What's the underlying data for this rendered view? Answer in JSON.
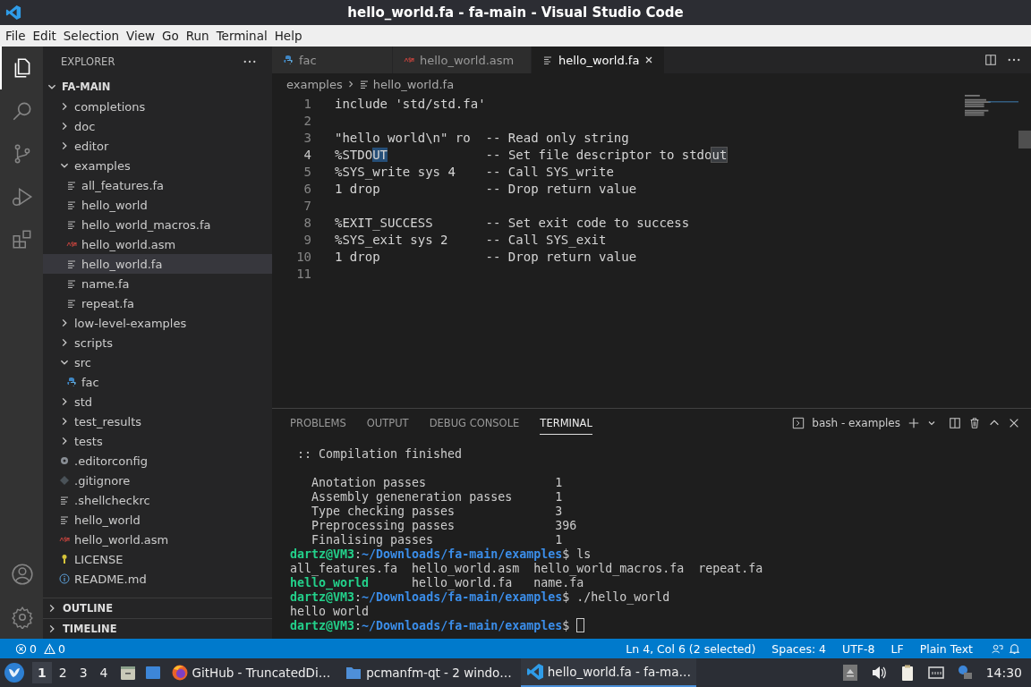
{
  "window": {
    "title": "hello_world.fa - fa-main - Visual Studio Code"
  },
  "menu": [
    "File",
    "Edit",
    "Selection",
    "View",
    "Go",
    "Run",
    "Terminal",
    "Help"
  ],
  "activity": [
    {
      "kind": "files",
      "selected": true
    },
    {
      "kind": "search",
      "selected": false
    },
    {
      "kind": "git",
      "selected": false
    },
    {
      "kind": "debug",
      "selected": false
    },
    {
      "kind": "extensions",
      "selected": false
    }
  ],
  "activity_bottom": [
    {
      "kind": "account"
    },
    {
      "kind": "settings"
    }
  ],
  "explorer": {
    "title": "EXPLORER",
    "root": {
      "label": "FA-MAIN",
      "expanded": true,
      "children": [
        {
          "label": "completions",
          "kind": "folder",
          "expanded": false
        },
        {
          "label": "doc",
          "kind": "folder",
          "expanded": false
        },
        {
          "label": "editor",
          "kind": "folder",
          "expanded": false
        },
        {
          "label": "examples",
          "kind": "folder",
          "expanded": true,
          "children": [
            {
              "label": "all_features.fa",
              "kind": "text",
              "selected": false
            },
            {
              "label": "hello_world",
              "kind": "text",
              "selected": false
            },
            {
              "label": "hello_world_macros.fa",
              "kind": "text",
              "selected": false
            },
            {
              "label": "hello_world.asm",
              "kind": "asm",
              "selected": false
            },
            {
              "label": "hello_world.fa",
              "kind": "text",
              "selected": true
            },
            {
              "label": "name.fa",
              "kind": "text",
              "selected": false
            },
            {
              "label": "repeat.fa",
              "kind": "text",
              "selected": false
            }
          ]
        },
        {
          "label": "low-level-examples",
          "kind": "folder",
          "expanded": false
        },
        {
          "label": "scripts",
          "kind": "folder",
          "expanded": false
        },
        {
          "label": "src",
          "kind": "folder",
          "expanded": true,
          "children": [
            {
              "label": "fac",
              "kind": "python",
              "selected": false
            }
          ]
        },
        {
          "label": "std",
          "kind": "folder",
          "expanded": false
        },
        {
          "label": "test_results",
          "kind": "folder",
          "expanded": false
        },
        {
          "label": "tests",
          "kind": "folder",
          "expanded": false
        },
        {
          "label": ".editorconfig",
          "kind": "gear",
          "selected": false
        },
        {
          "label": ".gitignore",
          "kind": "git",
          "selected": false
        },
        {
          "label": ".shellcheckrc",
          "kind": "text",
          "selected": false
        },
        {
          "label": "hello_world",
          "kind": "text",
          "selected": false
        },
        {
          "label": "hello_world.asm",
          "kind": "asm",
          "selected": false
        },
        {
          "label": "LICENSE",
          "kind": "license",
          "selected": false
        },
        {
          "label": "README.md",
          "kind": "info",
          "selected": false
        }
      ]
    }
  },
  "sections": [
    {
      "label": "OUTLINE",
      "expanded": false
    },
    {
      "label": "TIMELINE",
      "expanded": false
    }
  ],
  "tabs": [
    {
      "label": "fac",
      "kind": "python",
      "selected": false
    },
    {
      "label": "hello_world.asm",
      "kind": "asm",
      "selected": false
    },
    {
      "label": "hello_world.fa",
      "kind": "text",
      "selected": true
    }
  ],
  "breadcrumb": [
    "examples",
    "hello_world.fa"
  ],
  "code": [
    {
      "number": "1",
      "current": false,
      "parts": [
        {
          "text": "include 'std/std.fa'"
        }
      ]
    },
    {
      "number": "2",
      "current": false
    },
    {
      "number": "3",
      "current": false,
      "parts": [
        {
          "text": "\"hello world\\n\" ro  -- Read only string"
        }
      ]
    },
    {
      "number": "4",
      "current": true,
      "parts": [
        {
          "text": "%STDO",
          "selected": false,
          "match": false
        },
        {
          "text": "UT",
          "selected": true,
          "match": false
        },
        {
          "text": "             -- Set file descriptor to stdo",
          "selected": false,
          "match": false
        },
        {
          "text": "ut",
          "selected": false,
          "match": true
        }
      ]
    },
    {
      "number": "5",
      "current": false,
      "parts": [
        {
          "text": "%SYS_write sys 4    -- Call SYS_write"
        }
      ]
    },
    {
      "number": "6",
      "current": false,
      "parts": [
        {
          "text": "1 drop              -- Drop return value"
        }
      ]
    },
    {
      "number": "7",
      "current": false
    },
    {
      "number": "8",
      "current": false,
      "parts": [
        {
          "text": "%EXIT_SUCCESS       -- Set exit code to success"
        }
      ]
    },
    {
      "number": "9",
      "current": false,
      "parts": [
        {
          "text": "%SYS_exit sys 2     -- Call SYS_exit"
        }
      ]
    },
    {
      "number": "10",
      "current": false,
      "parts": [
        {
          "text": "1 drop              -- Drop return value"
        }
      ]
    },
    {
      "number": "11",
      "current": false
    }
  ],
  "panel": {
    "tabs": [
      {
        "label": "PROBLEMS",
        "selected": false
      },
      {
        "label": "OUTPUT",
        "selected": false
      },
      {
        "label": "DEBUG CONSOLE",
        "selected": false
      },
      {
        "label": "TERMINAL",
        "selected": true
      }
    ],
    "terminal_name": "bash - examples",
    "lines": [
      {
        "kind": "text",
        "parts": [
          {
            "kind": "plain",
            "text": " :: Compilation finished"
          }
        ]
      },
      {
        "kind": "blank"
      },
      {
        "kind": "text",
        "parts": [
          {
            "kind": "plain",
            "text": "   Anotation passes                  1"
          }
        ]
      },
      {
        "kind": "text",
        "parts": [
          {
            "kind": "plain",
            "text": "   Assembly geneneration passes      1"
          }
        ]
      },
      {
        "kind": "text",
        "parts": [
          {
            "kind": "plain",
            "text": "   Type checking passes              3"
          }
        ]
      },
      {
        "kind": "text",
        "parts": [
          {
            "kind": "plain",
            "text": "   Preprocessing passes              396"
          }
        ]
      },
      {
        "kind": "text",
        "parts": [
          {
            "kind": "plain",
            "text": "   Finalising passes                 1"
          }
        ]
      },
      {
        "kind": "text",
        "parts": [
          {
            "kind": "user",
            "text": "dartz@VM3"
          },
          {
            "kind": "plain",
            "text": ":"
          },
          {
            "kind": "path",
            "text": "~/Downloads/fa-main/examples"
          },
          {
            "kind": "plain",
            "text": "$ ls"
          }
        ]
      },
      {
        "kind": "text",
        "parts": [
          {
            "kind": "plain",
            "text": "all_features.fa  hello_world.asm  hello_world_macros.fa  repeat.fa"
          }
        ]
      },
      {
        "kind": "text",
        "parts": [
          {
            "kind": "exec",
            "text": "hello_world"
          },
          {
            "kind": "plain",
            "text": "      hello_world.fa   name.fa"
          }
        ]
      },
      {
        "kind": "text",
        "parts": [
          {
            "kind": "user",
            "text": "dartz@VM3"
          },
          {
            "kind": "plain",
            "text": ":"
          },
          {
            "kind": "path",
            "text": "~/Downloads/fa-main/examples"
          },
          {
            "kind": "plain",
            "text": "$ ./hello_world"
          }
        ]
      },
      {
        "kind": "text",
        "parts": [
          {
            "kind": "plain",
            "text": "hello world"
          }
        ]
      },
      {
        "kind": "text",
        "cursor": true,
        "parts": [
          {
            "kind": "user",
            "text": "dartz@VM3"
          },
          {
            "kind": "plain",
            "text": ":"
          },
          {
            "kind": "path",
            "text": "~/Downloads/fa-main/examples"
          },
          {
            "kind": "plain",
            "text": "$ "
          }
        ]
      }
    ]
  },
  "status_bar": {
    "errors": "0",
    "warnings": "0",
    "items": [
      "Ln 4, Col 6 (2 selected)",
      "Spaces: 4",
      "UTF-8",
      "LF",
      "Plain Text"
    ]
  },
  "taskbar": {
    "workspaces": [
      {
        "label": "1",
        "selected": true
      },
      {
        "label": "2",
        "selected": false
      },
      {
        "label": "3",
        "selected": false
      },
      {
        "label": "4",
        "selected": false
      }
    ],
    "tasks": [
      {
        "label": "GitHub - TruncatedDi…",
        "kind": "firefox",
        "selected": false
      },
      {
        "label": "pcmanfm-qt - 2 windo…",
        "kind": "folder",
        "selected": false
      },
      {
        "label": "hello_world.fa - fa-ma…",
        "kind": "vscode",
        "selected": true
      }
    ],
    "clock": "14:30"
  }
}
